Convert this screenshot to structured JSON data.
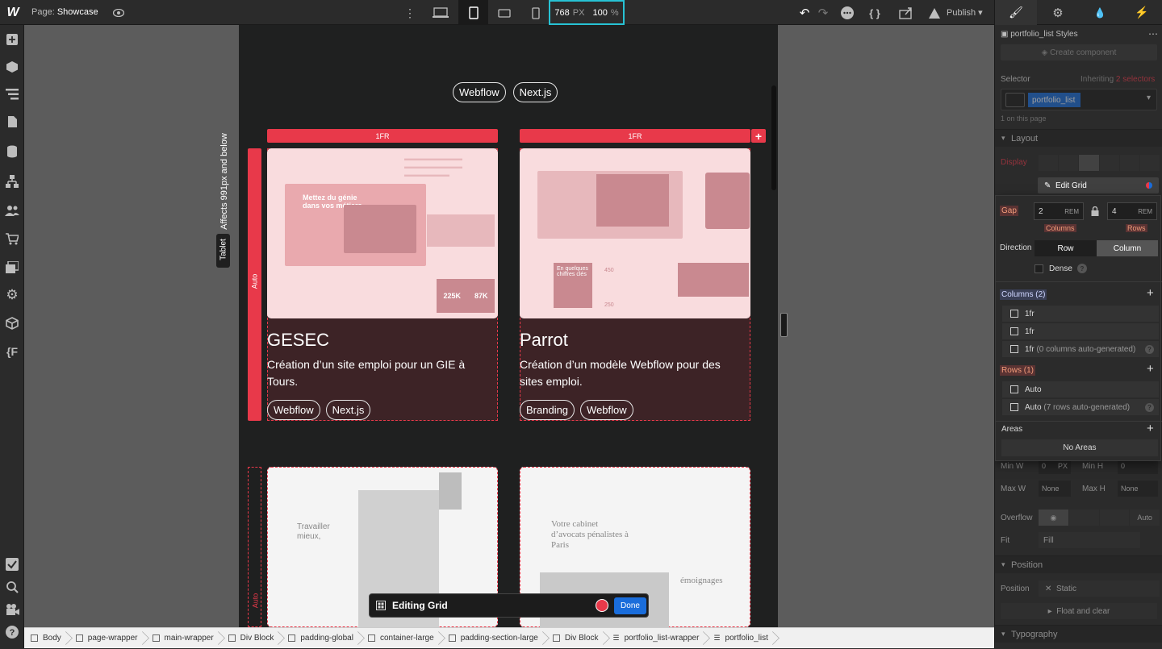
{
  "topbar": {
    "page_label": "Page:",
    "page_name": "Showcase",
    "width_value": "768",
    "width_unit": "PX",
    "zoom_value": "100",
    "zoom_unit": "%",
    "publish_label": "Publish"
  },
  "canvas": {
    "affects_label": "Affects 991px and below",
    "tablet_label": "Tablet",
    "top_tags": [
      "Webflow",
      "Next.js"
    ],
    "col_track_1": "1FR",
    "col_track_2": "1FR",
    "row_track_1": "Auto",
    "row_track_2": "Auto",
    "cards": [
      {
        "title": "GESEC",
        "desc": "Création d’un site emploi pour un GIE à Tours.",
        "tags": [
          "Webflow",
          "Next.js"
        ],
        "img_text": "Mettez du génie dans vos métiers",
        "stat1": "225K",
        "stat2": "87K"
      },
      {
        "title": "Parrot",
        "desc": "Création d’un modèle Webflow pour des sites emploi.",
        "tags": [
          "Branding",
          "Webflow"
        ],
        "img_text": "En quelques chiffres clés",
        "stat1": "450",
        "stat2": "250"
      }
    ],
    "card3_text": "Travailler mieux,",
    "card4_text": "Votre cabinet d’avocats pénalistes à Paris",
    "card4_sub": "émoignages",
    "editing_label": "Editing Grid",
    "done_label": "Done"
  },
  "breadcrumbs": [
    "Body",
    "page-wrapper",
    "main-wrapper",
    "Div Block",
    "padding-global",
    "container-large",
    "padding-section-large",
    "Div Block",
    "portfolio_list-wrapper",
    "portfolio_list"
  ],
  "panel": {
    "styles_title": "portfolio_list Styles",
    "create_component": "Create component",
    "selector_label": "Selector",
    "inheriting_label": "Inheriting",
    "inheriting_count": "2 selectors",
    "selector_chip": "portfolio_list",
    "on_page": "1 on this page",
    "layout_title": "Layout",
    "display_label": "Display",
    "edit_grid_label": "Edit Grid",
    "gap_label": "Gap",
    "gap_col_value": "2",
    "gap_col_unit": "REM",
    "gap_row_value": "4",
    "gap_row_unit": "REM",
    "columns_sub": "Columns",
    "rows_sub": "Rows",
    "direction_label": "Direction",
    "dir_row": "Row",
    "dir_column": "Column",
    "dense_label": "Dense",
    "columns_header": "Columns (2)",
    "columns_items": [
      "1fr",
      "1fr",
      "1fr"
    ],
    "columns_autogen": "(0 columns auto-generated)",
    "rows_header": "Rows (1)",
    "rows_items": [
      "Auto",
      "Auto"
    ],
    "rows_autogen": "(7 rows auto-generated)",
    "areas_label": "Areas",
    "no_areas": "No Areas",
    "min_w": "Min W",
    "min_h": "Min H",
    "max_w": "Max W",
    "max_h": "Max H",
    "none": "None",
    "zero": "0",
    "px": "PX",
    "overflow_label": "Overflow",
    "overflow_auto": "Auto",
    "fit_label": "Fit",
    "fit_value": "Fill",
    "position_title": "Position",
    "position_label": "Position",
    "position_value": "Static",
    "float_label": "Float and clear",
    "typography_title": "Typography"
  },
  "colors": {
    "accent": "#e8394a",
    "highlight": "#27c2d4",
    "blue": "#1a6ddb"
  }
}
